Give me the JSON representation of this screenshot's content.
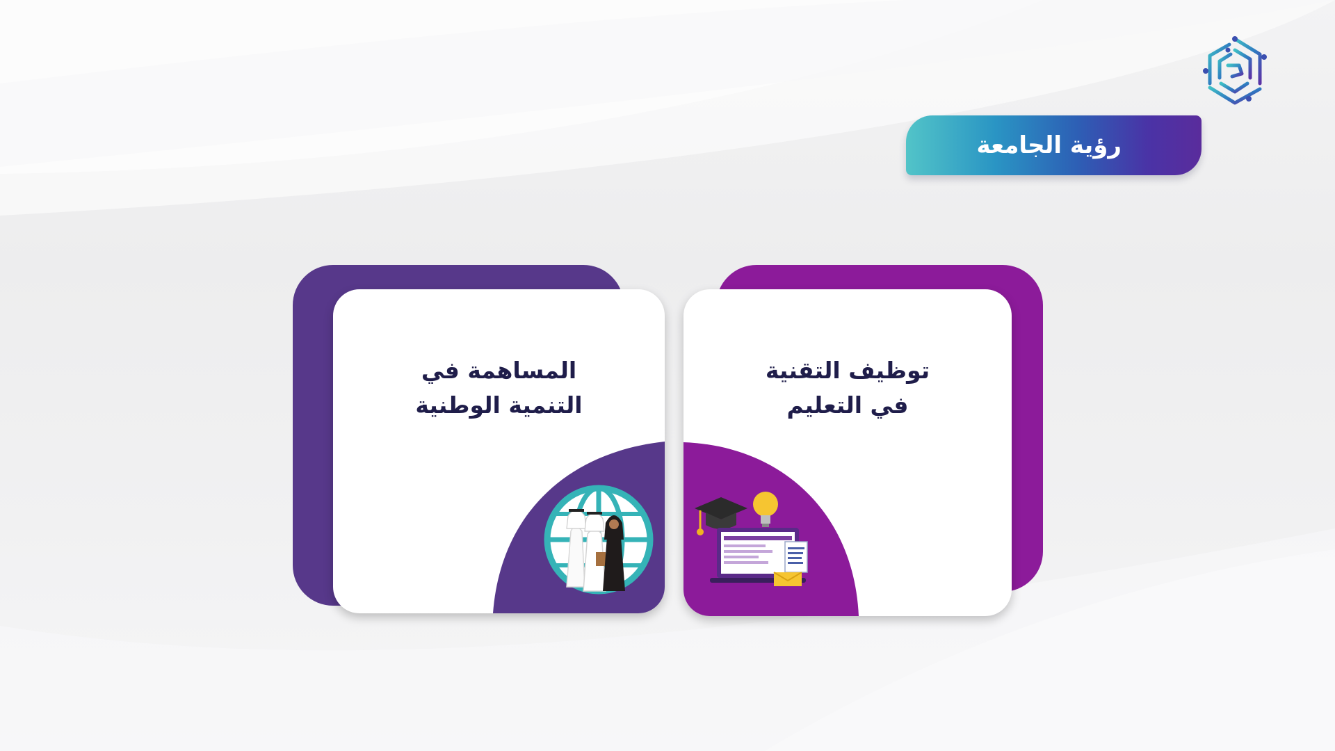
{
  "header": {
    "title": "رؤية الجامعة"
  },
  "logo": {
    "icon": "university-logo-icon"
  },
  "cards": [
    {
      "line1": "توظيف التقنية",
      "line2": "في التعليم",
      "illustration": "education-technology-illustration",
      "accent": "#8c1b9a"
    },
    {
      "line1": "المساهمة في",
      "line2": "التنمية الوطنية",
      "illustration": "national-development-people-globe-illustration",
      "accent": "#57388a"
    }
  ],
  "colors": {
    "navy_text": "#1f1d4a",
    "teal": "#3bb0b4",
    "purple": "#57388a",
    "magenta": "#8c1b9a"
  }
}
